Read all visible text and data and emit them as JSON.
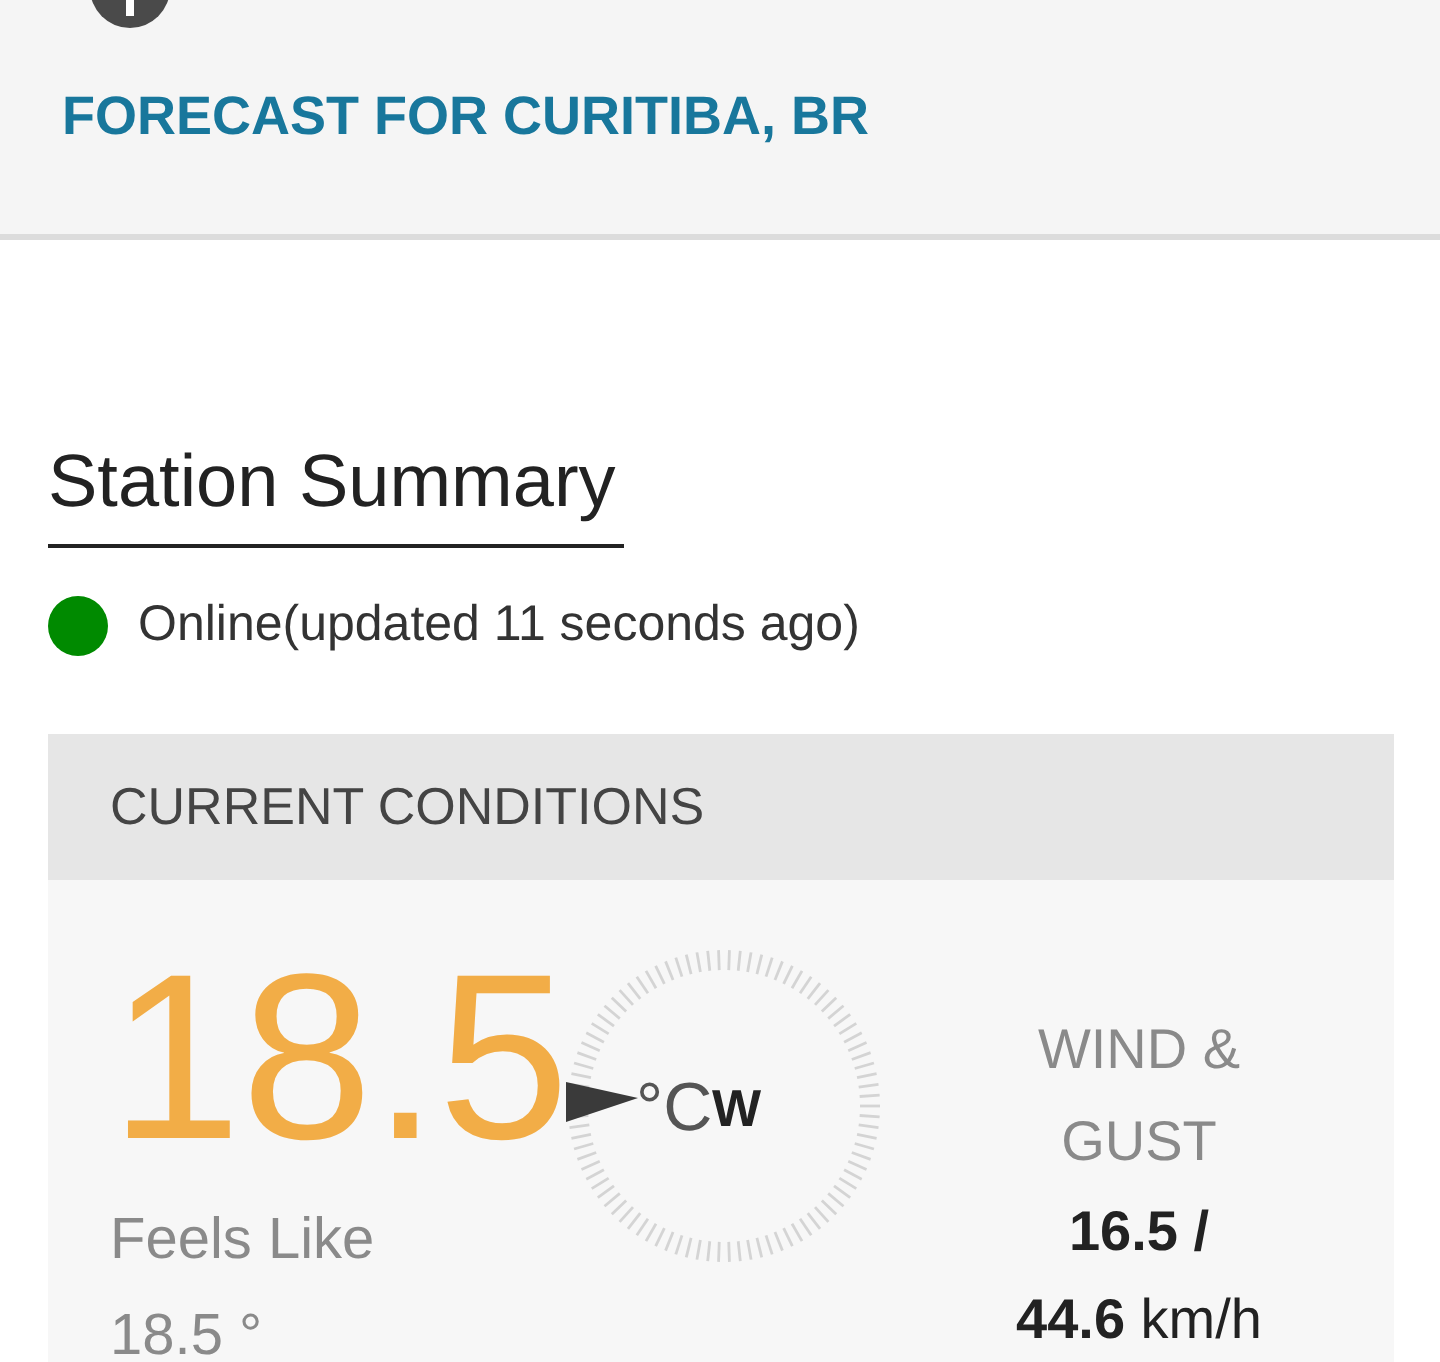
{
  "header": {
    "title": "FORECAST FOR CURITIBA, BR"
  },
  "station_summary": {
    "heading": "Station Summary",
    "status": {
      "text": "Online(updated 11 seconds ago)",
      "color": "#008a00"
    }
  },
  "current_conditions": {
    "heading": "CURRENT CONDITIONS",
    "temperature": "18.5",
    "unit": "°C",
    "wind_direction": "W",
    "feels_like_label": "Feels Like",
    "feels_like_value": "18.5 °",
    "wind_label": "WIND & GUST",
    "wind_value": "**16.5  /**\n**44.6** km/h"
  }
}
